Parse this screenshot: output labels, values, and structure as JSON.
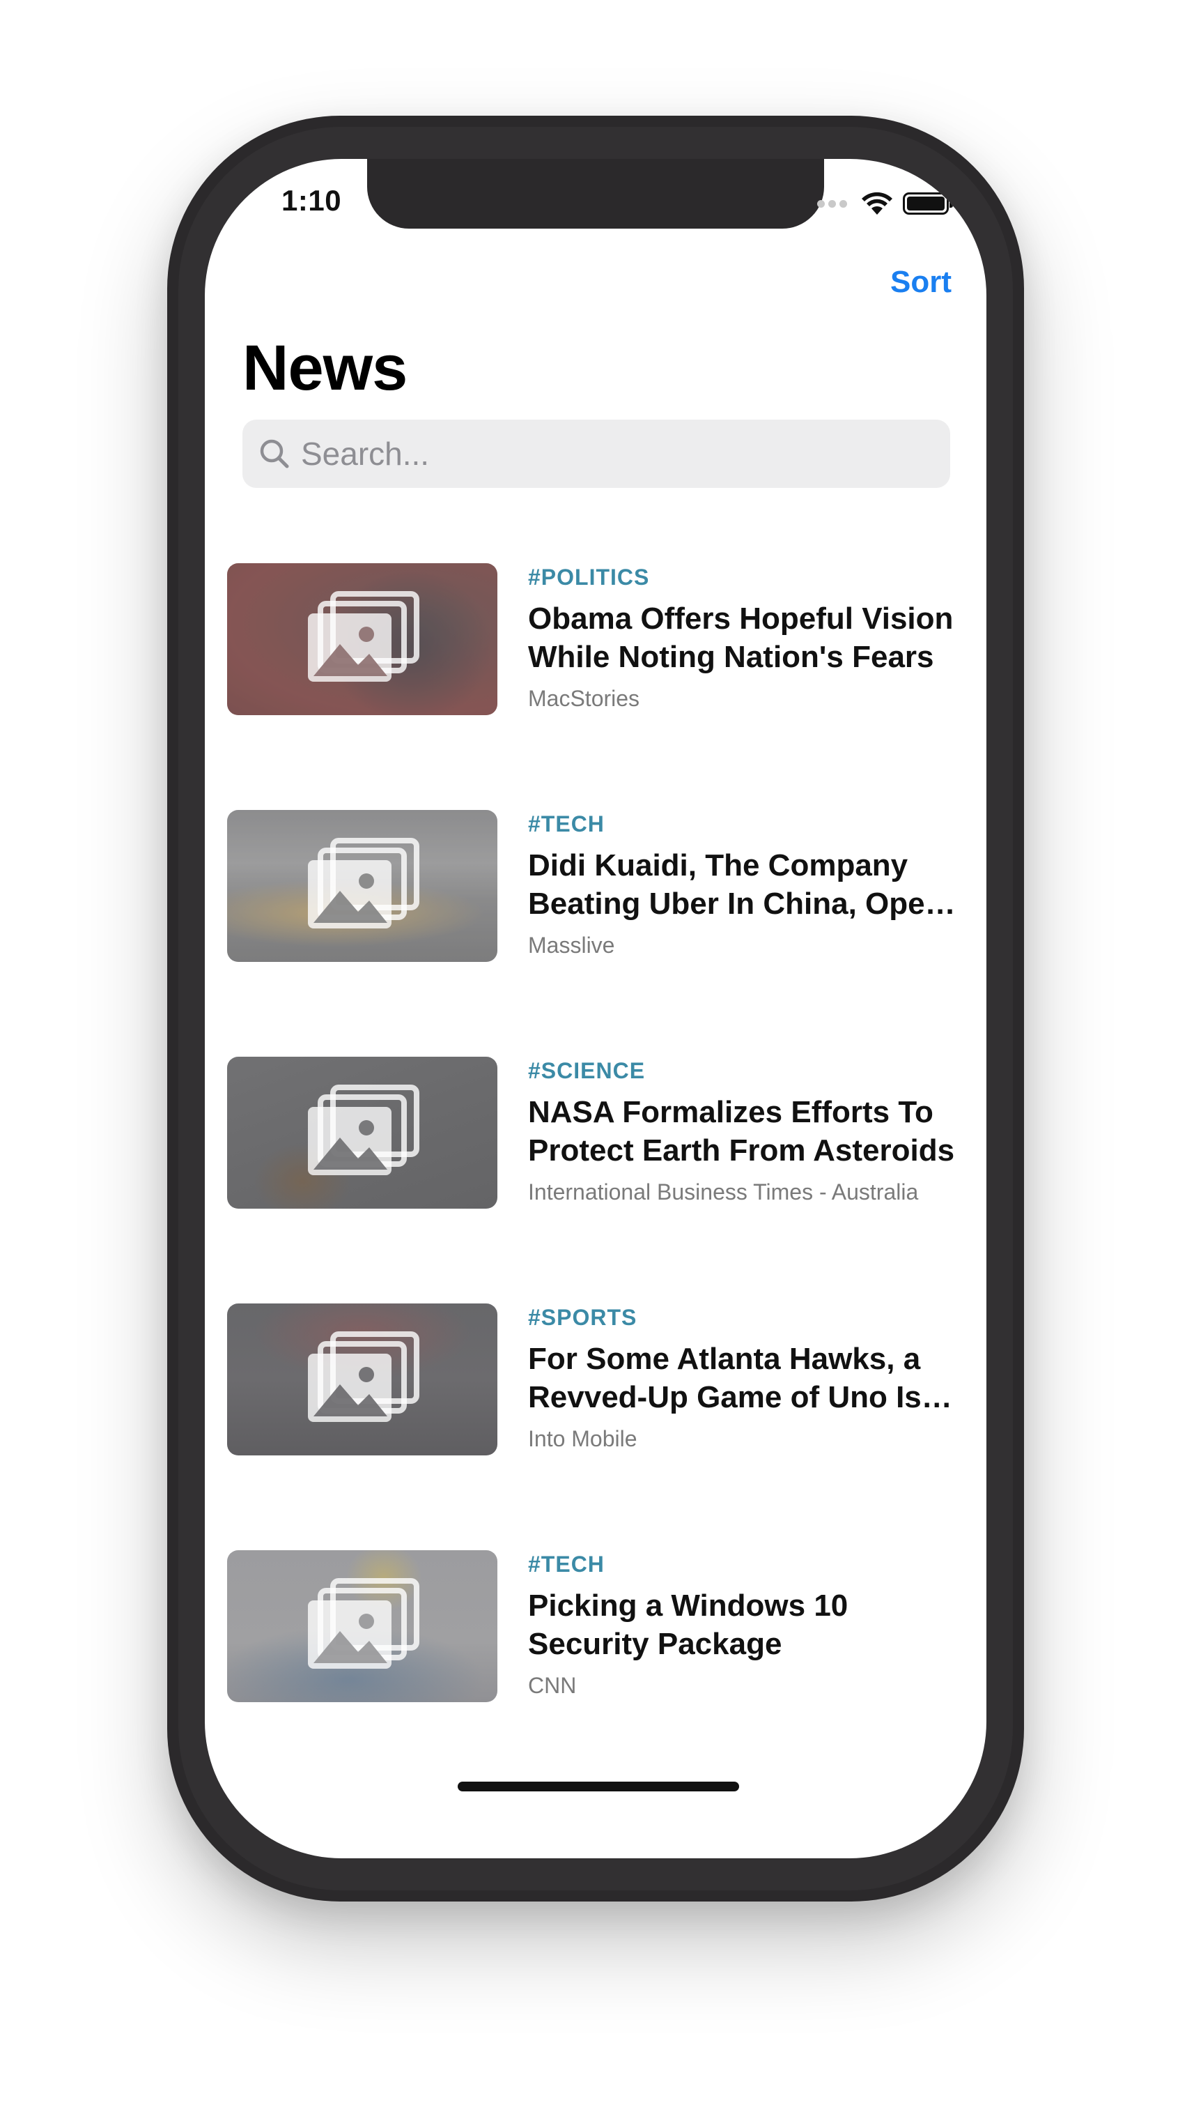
{
  "status_bar": {
    "time": "1:10",
    "icons": [
      "cellular-signal-icon",
      "wifi-icon",
      "battery-icon"
    ]
  },
  "nav": {
    "sort_label": "Sort",
    "title": "News"
  },
  "search": {
    "placeholder": "Search..."
  },
  "colors": {
    "accent": "#1a7ff0",
    "tag": "#3b8aa6",
    "source": "#7a7a7a"
  },
  "articles": [
    {
      "tag": "#POLITICS",
      "headline": "Obama Offers Hopeful Vision While Noting Nation's Fears",
      "source": "MacStories",
      "thumbnail_icon": "image-placeholder-icon"
    },
    {
      "tag": "#TECH",
      "headline": "Didi Kuaidi, The Company Beating Uber In China, Opens Its API",
      "source": "Masslive",
      "thumbnail_icon": "image-placeholder-icon"
    },
    {
      "tag": "#SCIENCE",
      "headline": "NASA Formalizes Efforts To Protect Earth From Asteroids",
      "source": "International Business Times - Australia",
      "thumbnail_icon": "image-placeholder-icon"
    },
    {
      "tag": "#SPORTS",
      "headline": "For Some Atlanta Hawks, a Revved-Up Game of Uno Is Life",
      "source": "Into Mobile",
      "thumbnail_icon": "image-placeholder-icon"
    },
    {
      "tag": "#TECH",
      "headline": "Picking a Windows 10 Security Package",
      "source": "CNN",
      "thumbnail_icon": "image-placeholder-icon"
    }
  ]
}
